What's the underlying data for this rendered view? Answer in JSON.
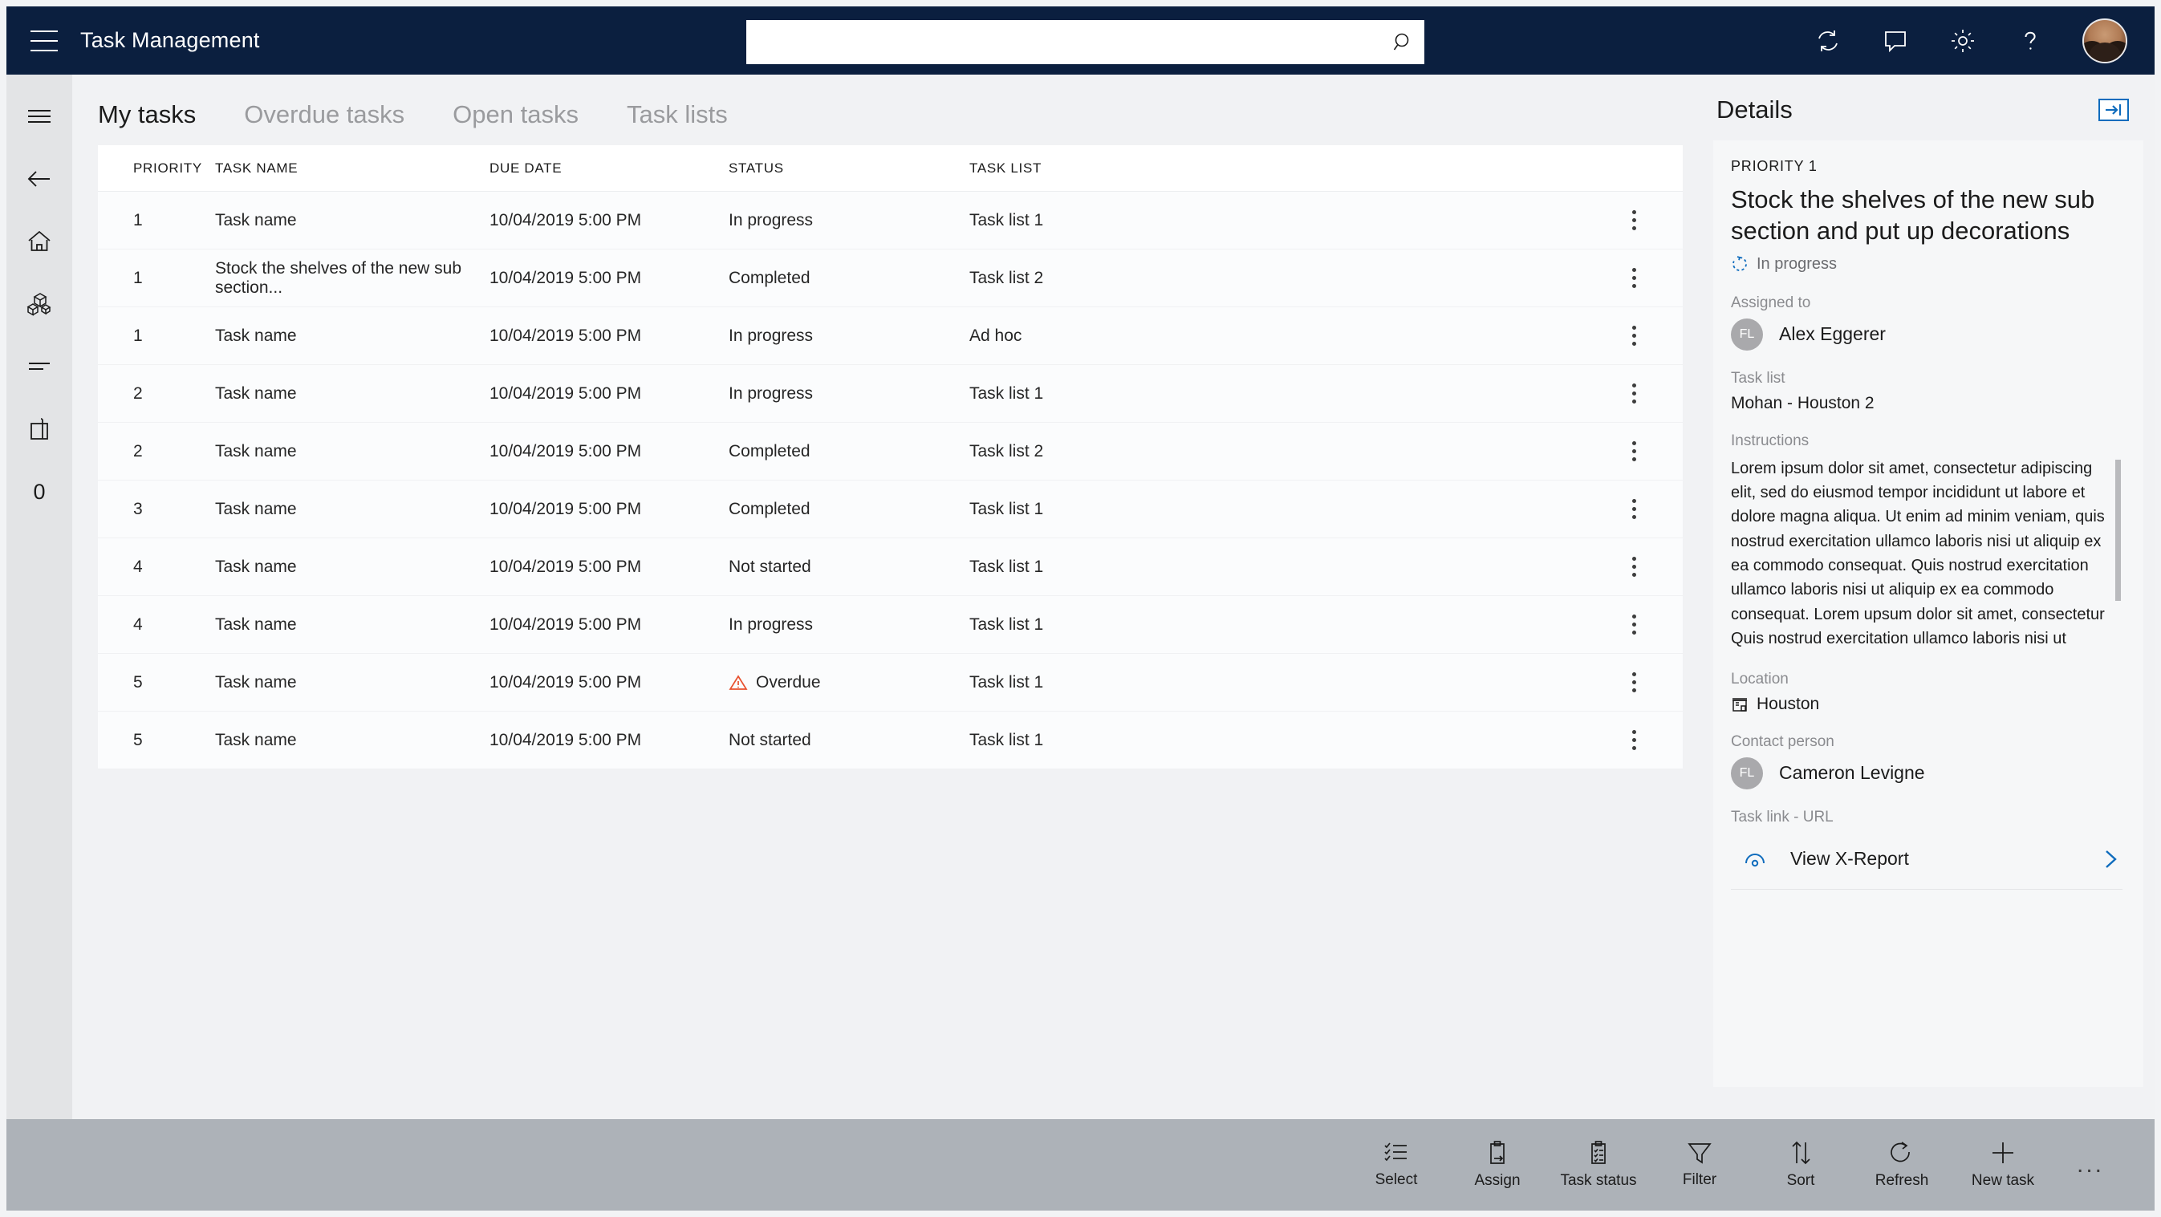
{
  "header": {
    "menu_icon": "hamburger-icon",
    "title": "Task Management",
    "search": {
      "value": "",
      "placeholder": ""
    },
    "actions": [
      {
        "name": "refresh-icon",
        "label": "Refresh"
      },
      {
        "name": "feedback-icon",
        "label": "Feedback"
      },
      {
        "name": "settings-icon",
        "label": "Settings"
      },
      {
        "name": "help-icon",
        "label": "Help"
      }
    ],
    "avatar": "user-avatar"
  },
  "sidebar": {
    "items": [
      {
        "icon": "hamburger-icon",
        "label": "Menu"
      },
      {
        "icon": "back-arrow-icon",
        "label": "Back"
      },
      {
        "icon": "home-icon",
        "label": "Home"
      },
      {
        "icon": "products-icon",
        "label": "Products"
      },
      {
        "icon": "list-icon",
        "label": "List"
      },
      {
        "icon": "shopping-bag-icon",
        "label": "Cart"
      },
      {
        "icon": "counter",
        "label": "0"
      }
    ],
    "counter": "0"
  },
  "tabs": [
    {
      "label": "My tasks",
      "active": true
    },
    {
      "label": "Overdue tasks",
      "active": false
    },
    {
      "label": "Open tasks",
      "active": false
    },
    {
      "label": "Task lists",
      "active": false
    }
  ],
  "table": {
    "columns": [
      "PRIORITY",
      "TASK NAME",
      "DUE DATE",
      "STATUS",
      "TASK LIST"
    ],
    "rows": [
      {
        "priority": "1",
        "name": "Task name",
        "due": "10/04/2019 5:00 PM",
        "status": "In progress",
        "list": "Task list 1",
        "overdue": false
      },
      {
        "priority": "1",
        "name": "Stock the shelves of the new sub section...",
        "due": "10/04/2019 5:00 PM",
        "status": "Completed",
        "list": "Task list 2",
        "overdue": false
      },
      {
        "priority": "1",
        "name": "Task name",
        "due": "10/04/2019 5:00 PM",
        "status": "In progress",
        "list": "Ad hoc",
        "overdue": false
      },
      {
        "priority": "2",
        "name": "Task name",
        "due": "10/04/2019 5:00 PM",
        "status": "In progress",
        "list": "Task list 1",
        "overdue": false
      },
      {
        "priority": "2",
        "name": "Task name",
        "due": "10/04/2019 5:00 PM",
        "status": "Completed",
        "list": "Task list 2",
        "overdue": false
      },
      {
        "priority": "3",
        "name": "Task name",
        "due": "10/04/2019 5:00 PM",
        "status": "Completed",
        "list": "Task list 1",
        "overdue": false
      },
      {
        "priority": "4",
        "name": "Task name",
        "due": "10/04/2019 5:00 PM",
        "status": "Not started",
        "list": "Task list 1",
        "overdue": false
      },
      {
        "priority": "4",
        "name": "Task name",
        "due": "10/04/2019 5:00 PM",
        "status": "In progress",
        "list": "Task list 1",
        "overdue": false
      },
      {
        "priority": "5",
        "name": "Task name",
        "due": "10/04/2019 5:00 PM",
        "status": "Overdue",
        "list": "Task list 1",
        "overdue": true
      },
      {
        "priority": "5",
        "name": "Task name",
        "due": "10/04/2019 5:00 PM",
        "status": "Not started",
        "list": "Task list 1",
        "overdue": false
      }
    ]
  },
  "details": {
    "title": "Details",
    "expand_icon": "expand-panel-icon",
    "priority": "PRIORITY 1",
    "task_title": "Stock the shelves of the new sub section and put up decorations",
    "status": "In progress",
    "assigned_label": "Assigned to",
    "assigned_initials": "FL",
    "assigned_name": "Alex Eggerer",
    "tasklist_label": "Task list",
    "tasklist_value": "Mohan - Houston 2",
    "instructions_label": "Instructions",
    "instructions": "Lorem ipsum dolor sit amet, consectetur adipiscing elit, sed do eiusmod tempor incididunt ut labore et dolore magna aliqua. Ut enim ad minim veniam, quis nostrud exercitation ullamco laboris nisi ut aliquip ex ea commodo consequat. Quis nostrud exercitation ullamco laboris nisi ut aliquip ex ea commodo consequat. Lorem upsum dolor sit amet, consectetur Quis nostrud exercitation ullamco laboris nisi ut",
    "location_label": "Location",
    "location_value": "Houston",
    "contact_label": "Contact person",
    "contact_initials": "FL",
    "contact_name": "Cameron Levigne",
    "tasklink_label": "Task link - URL",
    "tasklink_value": "View X-Report"
  },
  "footer": {
    "buttons": [
      {
        "icon": "select-icon",
        "label": "Select"
      },
      {
        "icon": "assign-icon",
        "label": "Assign"
      },
      {
        "icon": "task-status-icon",
        "label": "Task status"
      },
      {
        "icon": "filter-icon",
        "label": "Filter"
      },
      {
        "icon": "sort-icon",
        "label": "Sort"
      },
      {
        "icon": "refresh-icon",
        "label": "Refresh"
      },
      {
        "icon": "new-task-icon",
        "label": "New task"
      }
    ],
    "overflow": "..."
  },
  "colors": {
    "header_bg": "#0b1f3f",
    "accent_blue": "#0f6cbd",
    "overdue_red": "#e8512f",
    "footer_bg": "#adb2b8"
  }
}
